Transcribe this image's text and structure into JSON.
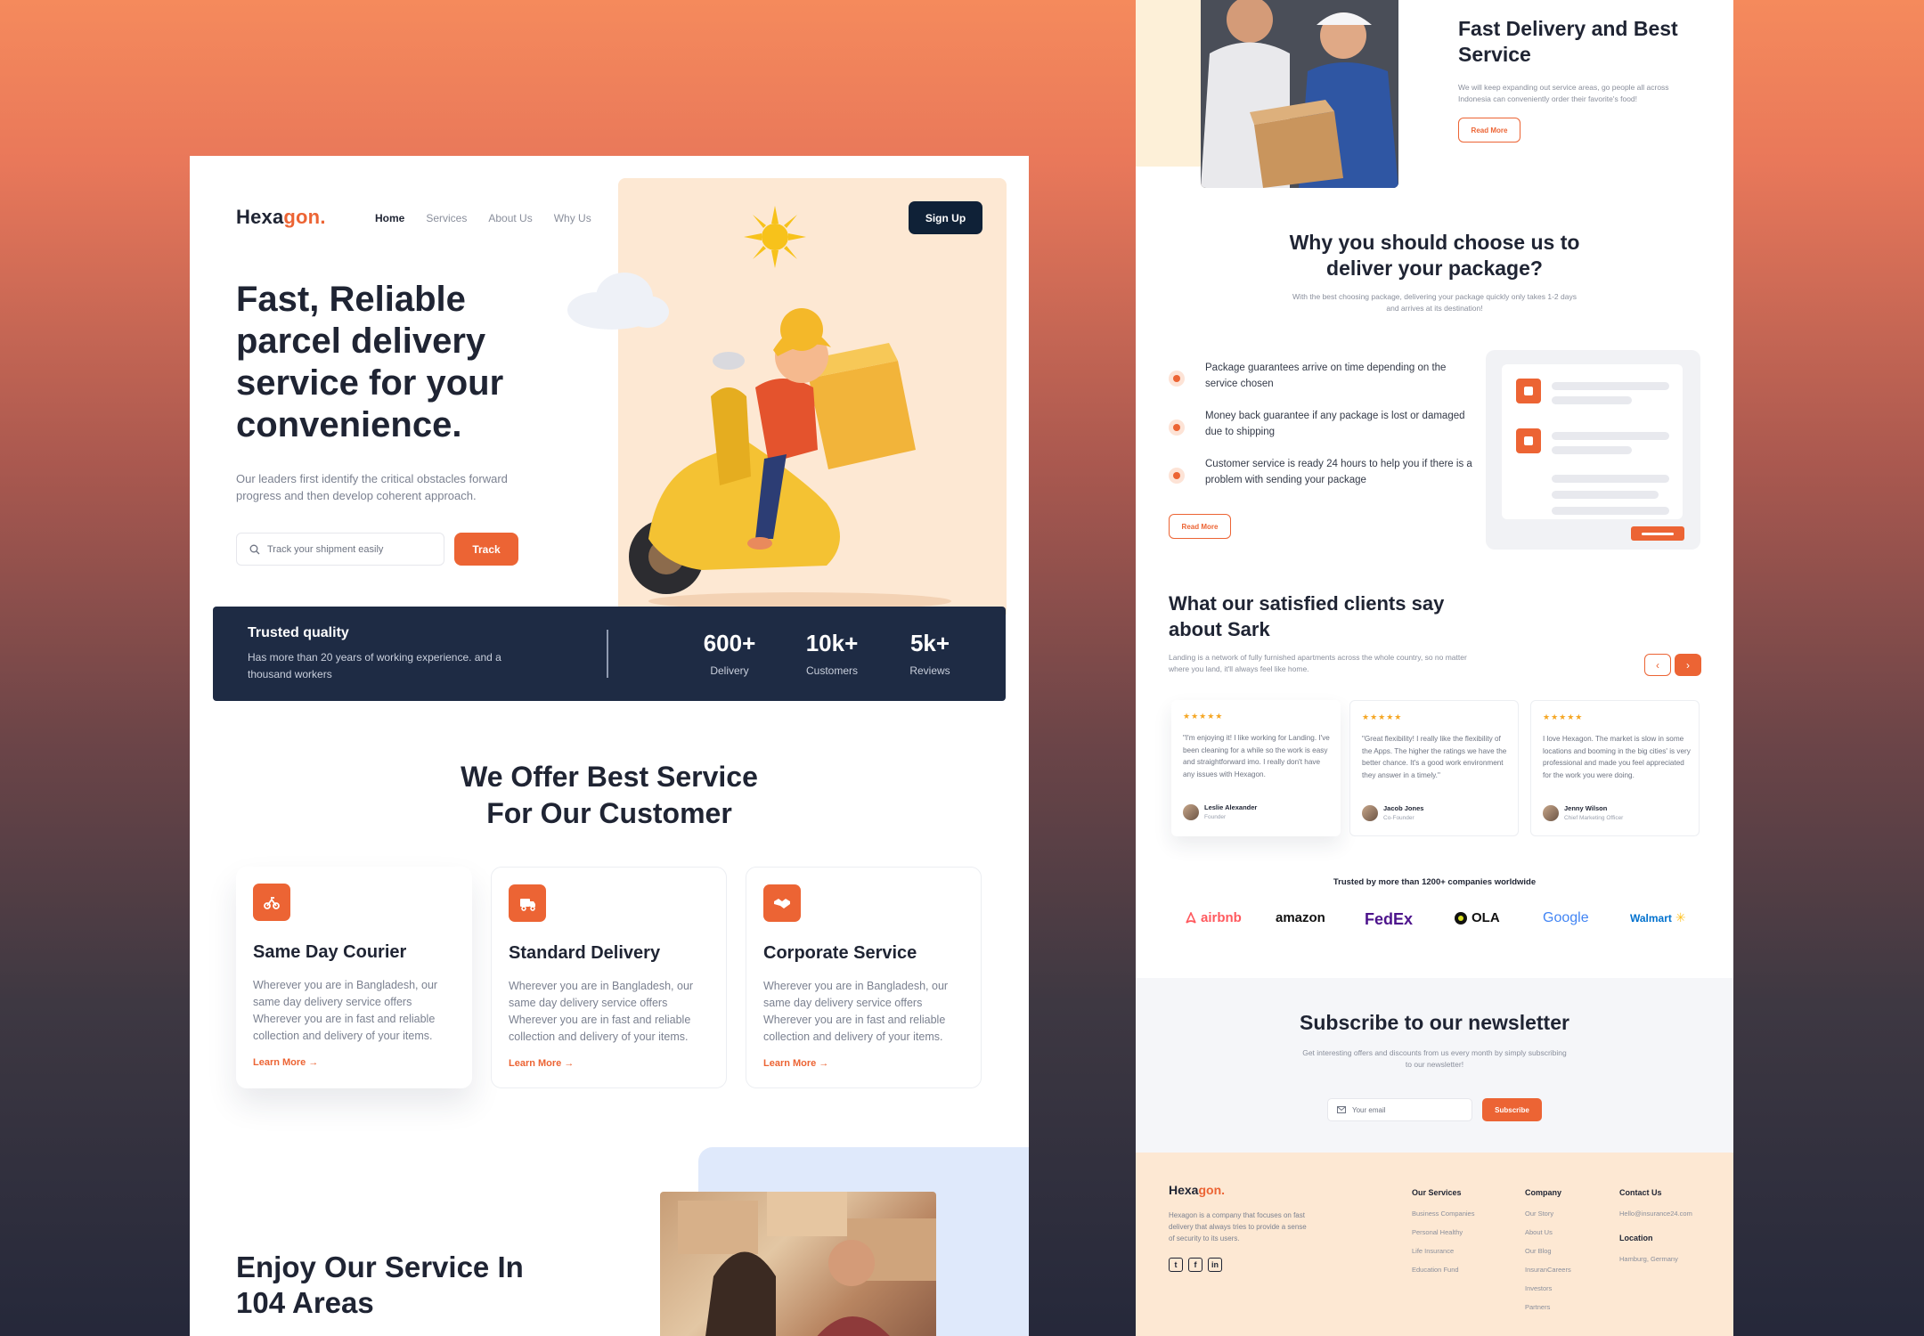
{
  "brand": {
    "name_main": "Hexa",
    "name_accent": "gon."
  },
  "nav": {
    "items": [
      "Home",
      "Services",
      "About Us",
      "Why Us"
    ],
    "signup_label": "Sign Up"
  },
  "hero": {
    "title": "Fast, Reliable parcel delivery service for your convenience.",
    "subtitle": "Our leaders first identify the critical obstacles forward progress and then develop coherent approach.",
    "track_placeholder": "Track your shipment easily",
    "track_label": "Track"
  },
  "stats": {
    "title": "Trusted quality",
    "description": "Has more than 20 years of working experience. and a thousand workers",
    "items": [
      {
        "value": "600+",
        "label": "Delivery"
      },
      {
        "value": "10k+",
        "label": "Customers"
      },
      {
        "value": "5k+",
        "label": "Reviews"
      }
    ]
  },
  "services": {
    "title": "We Offer Best Service For Our Customer",
    "cards": [
      {
        "title": "Same Day Courier",
        "body": "Wherever you are in Bangladesh, our same day delivery service offers Wherever you are in fast and reliable collection and delivery of your items.",
        "link": "Learn More",
        "icon": "courier-icon"
      },
      {
        "title": "Standard Delivery",
        "body": "Wherever you are in Bangladesh, our same day delivery service offers Wherever you are in fast and reliable collection and delivery of your items.",
        "link": "Learn More",
        "icon": "truck-icon"
      },
      {
        "title": "Corporate Service",
        "body": "Wherever you are in Bangladesh, our same day delivery service offers Wherever you are in fast and reliable collection and delivery of your items.",
        "link": "Learn More",
        "icon": "handshake-icon"
      }
    ]
  },
  "areas": {
    "title": "Enjoy Our Service In 104 Areas"
  },
  "fast": {
    "title": "Fast Delivery and Best Service",
    "body": "We will keep expanding out service areas, go people all across Indonesia can conveniently order their favorite's food!",
    "button": "Read More"
  },
  "why": {
    "title": "Why you should choose us to deliver your package?",
    "subtitle": "With the best choosing package, delivering your package quickly only takes 1-2 days and arrives at its destination!",
    "features": [
      "Package guarantees arrive on time depending on the service chosen",
      "Money back guarantee if any package is lost or damaged due to shipping",
      "Customer service is ready 24 hours to help you if there is a problem with sending your package"
    ],
    "button": "Read More"
  },
  "testimonials": {
    "title": "What our satisfied clients say about Sark",
    "subtitle": "Landing is a network of fully furnished apartments across the whole country, so no matter where you land, it'll always feel like home.",
    "stars": "★★★★★",
    "items": [
      {
        "quote": "\"I'm enjoying it! I like working for Landing. I've been cleaning for a while so the work is easy and straightforward imo. I really don't have any issues with Hexagon.",
        "name": "Leslie Alexander",
        "role": "Founder"
      },
      {
        "quote": "\"Great flexibility! I really like the flexibility of the Apps. The higher the ratings we have the better chance. It's a good work environment they answer in a timely.\"",
        "name": "Jacob Jones",
        "role": "Co-Founder"
      },
      {
        "quote": "I love Hexagon. The market is slow in some locations and booming in the big cities' is very professional and made you feel appreciated for the work you were doing.",
        "name": "Jenny Wilson",
        "role": "Chief Marketing Officer"
      }
    ]
  },
  "trusted": {
    "title": "Trusted by more than 1200+ companies worldwide",
    "brands": [
      {
        "name": "airbnb",
        "color": "#ff5a5f"
      },
      {
        "name": "amazon",
        "color": "#111111"
      },
      {
        "name": "FedEx",
        "color": "#4d148c"
      },
      {
        "name": "OLA",
        "color": "#111111"
      },
      {
        "name": "Google",
        "color": "#4285f4"
      },
      {
        "name": "Walmart",
        "color": "#0071ce"
      }
    ]
  },
  "newsletter": {
    "title": "Subscribe to our newsletter",
    "subtitle": "Get interesting offers and discounts from us every month by simply subscribing to our newsletter!",
    "placeholder": "Your email",
    "button": "Subscribe"
  },
  "footer": {
    "description": "Hexagon is a company that focuses on fast delivery that always tries to provide a sense of security to its users.",
    "columns": [
      {
        "title": "Our Services",
        "links": [
          "Business Companies",
          "Personal Healthy",
          "Life Insurance",
          "Education Fund"
        ]
      },
      {
        "title": "Company",
        "links": [
          "Our Story",
          "About Us",
          "Our Blog",
          "InsuranCareers",
          "Investors",
          "Partners"
        ]
      }
    ],
    "contact_title": "Contact Us",
    "contact_email": "Hello@insurance24.com",
    "location_title": "Location",
    "location": "Hamburg, Germany"
  },
  "colors": {
    "accent": "#ec6434",
    "navy": "#1e2b44",
    "cream": "#fde8d3"
  }
}
